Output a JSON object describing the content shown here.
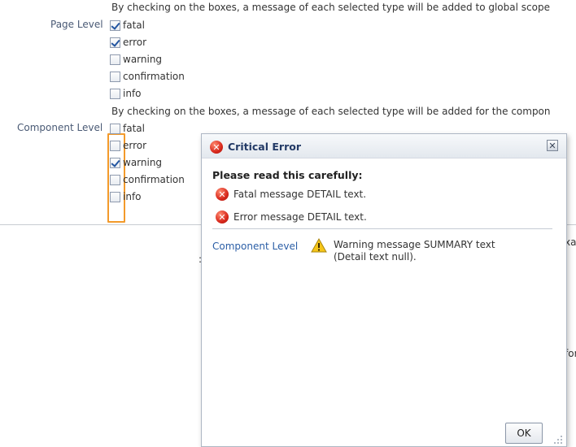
{
  "page_level": {
    "description": "By checking on the boxes, a message of each selected type will be added to global scope",
    "label": "Page Level",
    "options": [
      {
        "label": "fatal",
        "checked": true
      },
      {
        "label": "error",
        "checked": true
      },
      {
        "label": "warning",
        "checked": false
      },
      {
        "label": "confirmation",
        "checked": false
      },
      {
        "label": "info",
        "checked": false
      }
    ]
  },
  "component_level": {
    "description": "By checking on the boxes, a message of each selected type will be added for the compon",
    "label": "Component Level",
    "options": [
      {
        "label": "fatal",
        "checked": false
      },
      {
        "label": "error",
        "checked": false
      },
      {
        "label": "warning",
        "checked": true
      },
      {
        "label": "confirmation",
        "checked": false
      },
      {
        "label": "info",
        "checked": false
      }
    ]
  },
  "background_fragments": {
    "colon": ":",
    "right_a": "xar",
    "right_b": "for"
  },
  "dialog": {
    "title": "Critical Error",
    "heading": "Please read this carefully:",
    "messages": [
      {
        "icon": "error-icon",
        "text": "Fatal message DETAIL text."
      },
      {
        "icon": "error-icon",
        "text": "Error message DETAIL text."
      }
    ],
    "component_message": {
      "label": "Component Level",
      "icon": "warning-icon",
      "summary": "Warning message SUMMARY text",
      "detail": "(Detail text null)."
    },
    "ok_label": "OK",
    "close_icon": "close-icon"
  },
  "colors": {
    "focus_outline": "#f39a2b",
    "error_red": "#d8281c",
    "warning_yellow": "#f5c518",
    "link_blue": "#2b5ea6",
    "title_blue": "#233a66"
  }
}
